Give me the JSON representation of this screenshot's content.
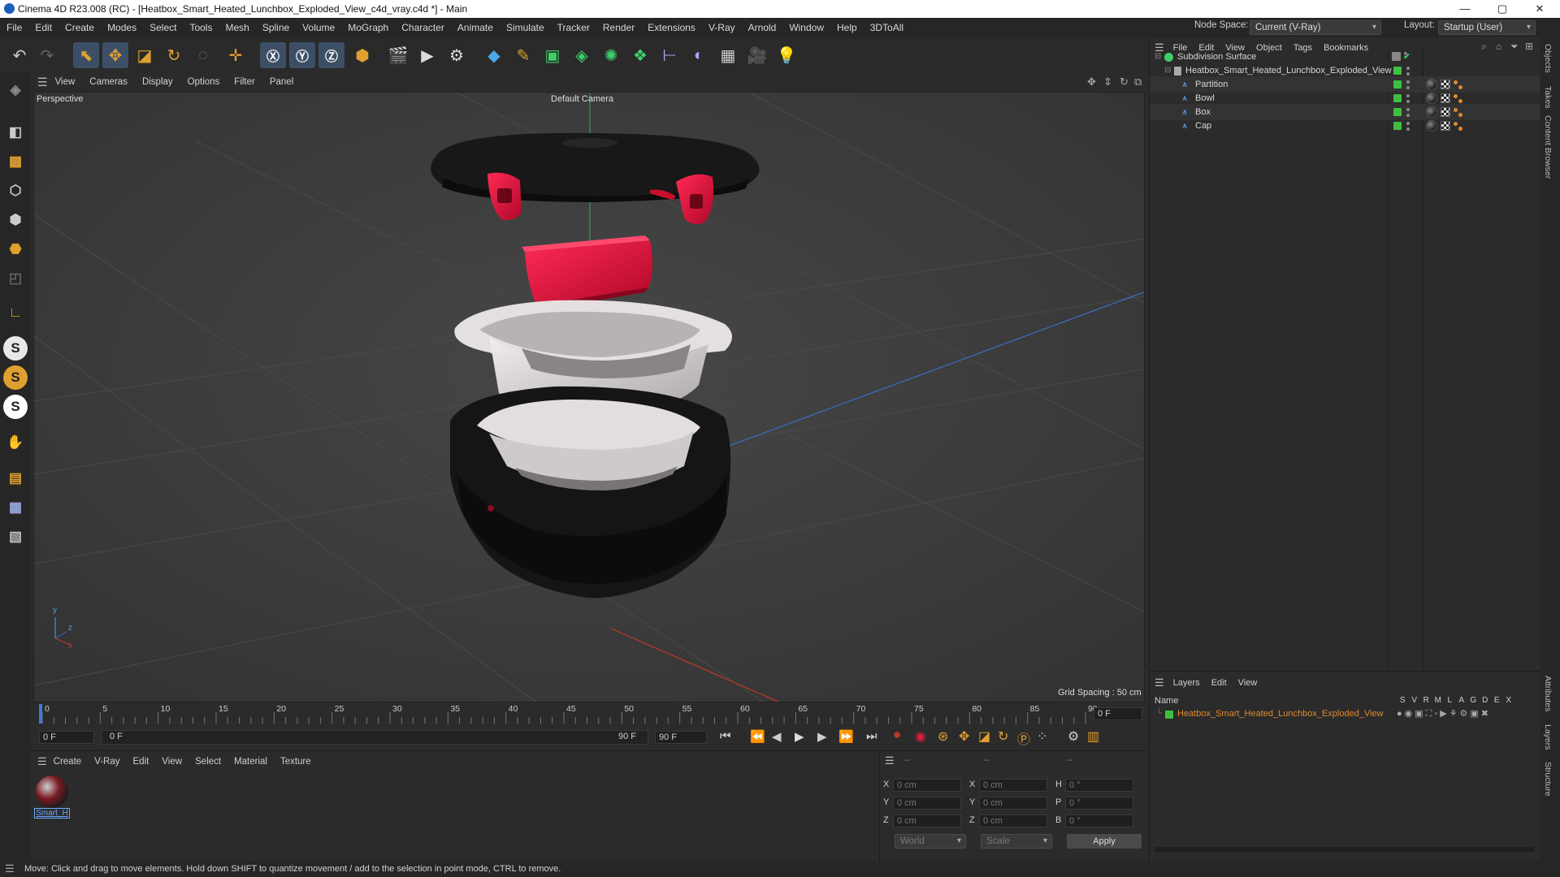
{
  "window": {
    "title": "Cinema 4D R23.008 (RC) - [Heatbox_Smart_Heated_Lunchbox_Exploded_View_c4d_vray.c4d *] - Main",
    "minimize": "—",
    "maximize": "▢",
    "close": "✕"
  },
  "menu": {
    "items": [
      "File",
      "Edit",
      "Create",
      "Modes",
      "Select",
      "Tools",
      "Mesh",
      "Spline",
      "Volume",
      "MoGraph",
      "Character",
      "Animate",
      "Simulate",
      "Tracker",
      "Render",
      "Extensions",
      "V-Ray",
      "Arnold",
      "Window",
      "Help",
      "3DToAll"
    ],
    "node_space_label": "Node Space:",
    "node_space_value": "Current (V-Ray)",
    "layout_label": "Layout:",
    "layout_value": "Startup (User)"
  },
  "viewport_menu": [
    "View",
    "Cameras",
    "Display",
    "Options",
    "Filter",
    "Panel"
  ],
  "viewport": {
    "name": "Perspective",
    "camera": "Default Camera",
    "grid_spacing": "Grid Spacing : 50 cm",
    "axis_y": "y",
    "axis_z": "z",
    "axis_x": "x"
  },
  "timeline": {
    "ticks": [
      "0",
      "5",
      "10",
      "15",
      "20",
      "25",
      "30",
      "35",
      "40",
      "45",
      "50",
      "55",
      "60",
      "65",
      "70",
      "75",
      "80",
      "85",
      "90"
    ],
    "current_frame": "0 F",
    "start_frame": "0 F",
    "range_start": "0 F",
    "range_end": "90 F",
    "end_frame": "90 F"
  },
  "object_manager": {
    "menu": [
      "File",
      "Edit",
      "View",
      "Object",
      "Tags",
      "Bookmarks"
    ],
    "objects": [
      {
        "name": "Subdivision Surface",
        "indent": 0
      },
      {
        "name": "Heatbox_Smart_Heated_Lunchbox_Exploded_View",
        "indent": 1
      },
      {
        "name": "Partition",
        "indent": 2
      },
      {
        "name": "Bowl",
        "indent": 2
      },
      {
        "name": "Box",
        "indent": 2
      },
      {
        "name": "Cap",
        "indent": 2
      }
    ]
  },
  "layers": {
    "menu": [
      "Layers",
      "Edit",
      "View"
    ],
    "name_header": "Name",
    "col_headers": [
      "S",
      "V",
      "R",
      "M",
      "L",
      "A",
      "G",
      "D",
      "E",
      "X"
    ],
    "layer_name": "Heatbox_Smart_Heated_Lunchbox_Exploded_View",
    "layer_color": "#3fbf3f"
  },
  "material_manager": {
    "menu": [
      "Create",
      "V-Ray",
      "Edit",
      "View",
      "Select",
      "Material",
      "Texture"
    ],
    "material_name": "Smart_H"
  },
  "coords": {
    "header": [
      "--",
      "--",
      "--"
    ],
    "rows": [
      {
        "a": "X",
        "av": "0 cm",
        "b": "X",
        "bv": "0 cm",
        "c": "H",
        "cv": "0 °"
      },
      {
        "a": "Y",
        "av": "0 cm",
        "b": "Y",
        "bv": "0 cm",
        "c": "P",
        "cv": "0 °"
      },
      {
        "a": "Z",
        "av": "0 cm",
        "b": "Z",
        "bv": "0 cm",
        "c": "B",
        "cv": "0 °"
      }
    ],
    "world": "World",
    "scale": "Scale",
    "apply": "Apply"
  },
  "right_tabs": [
    "Objects",
    "Takes",
    "Content Browser",
    "Attributes",
    "Layers",
    "Structure"
  ],
  "status": "Move: Click and drag to move elements. Hold down SHIFT to quantize movement / add to the selection in point mode, CTRL to remove.",
  "colors": {
    "accent": "#e08a2a",
    "model_red": "#e0103a",
    "model_black": "#161616",
    "model_white": "#d8d4d4"
  }
}
